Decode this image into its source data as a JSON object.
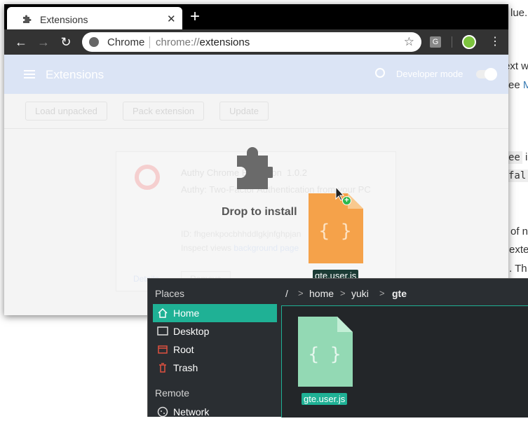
{
  "background_page": {
    "fragments": [
      {
        "text": "lue.",
        "type": "text"
      },
      {
        "text": "ext w",
        "type": "text"
      },
      {
        "text": "ee ",
        "type": "text",
        "link": "M"
      },
      {
        "text": "ee",
        "type": "code",
        "suffix": " is"
      },
      {
        "text": "fal",
        "type": "code"
      },
      {
        "text": "of n",
        "type": "text"
      },
      {
        "text": "exter",
        "type": "text"
      },
      {
        "text": ". Th",
        "type": "text"
      }
    ]
  },
  "browser": {
    "tab_title": "Extensions",
    "new_tab_symbol": "+",
    "omnibox": {
      "site_label": "Chrome",
      "url_scheme": "chrome://",
      "url_path": "extensions"
    },
    "ext_badge": "G"
  },
  "extensions_page": {
    "header_title": "Extensions",
    "developer_mode_label": "Developer mode",
    "developer_mode_on": true,
    "buttons": {
      "load_unpacked": "Load unpacked",
      "pack_extension": "Pack extension",
      "update": "Update"
    },
    "card": {
      "name": "Authy Chrome Extension",
      "version": "1.0.2",
      "description": "Authy: Two-Factor Authentication from your PC",
      "id_text": "ID: fhgenkpocbhhddlgkjnfghpjan",
      "inspect_label": "Inspect views",
      "inspect_link": "background page",
      "details_label": "Details",
      "remove_label": "Remove"
    },
    "drop_text": "Drop to install"
  },
  "drag": {
    "file_name": "gte.user.js",
    "file_glyph": "{ }",
    "plus_symbol": "+"
  },
  "file_manager": {
    "places_header": "Places",
    "places": [
      {
        "label": "Home",
        "icon": "home-icon",
        "selected": true
      },
      {
        "label": "Desktop",
        "icon": "desktop-icon",
        "selected": false
      },
      {
        "label": "Root",
        "icon": "root-icon",
        "selected": false
      },
      {
        "label": "Trash",
        "icon": "trash-icon",
        "selected": false
      }
    ],
    "remote_header": "Remote",
    "remote_items": [
      {
        "label": "Network",
        "icon": "network-icon"
      }
    ],
    "breadcrumb": {
      "root": "/",
      "home": "home",
      "user": "yuki",
      "current": "gte",
      "separator": ">"
    },
    "files": [
      {
        "name": "gte.user.js",
        "glyph": "{ }"
      }
    ]
  },
  "colors": {
    "accent": "#1fb195",
    "drag_file": "#f5a24a",
    "file_icon": "#93d9b4"
  }
}
